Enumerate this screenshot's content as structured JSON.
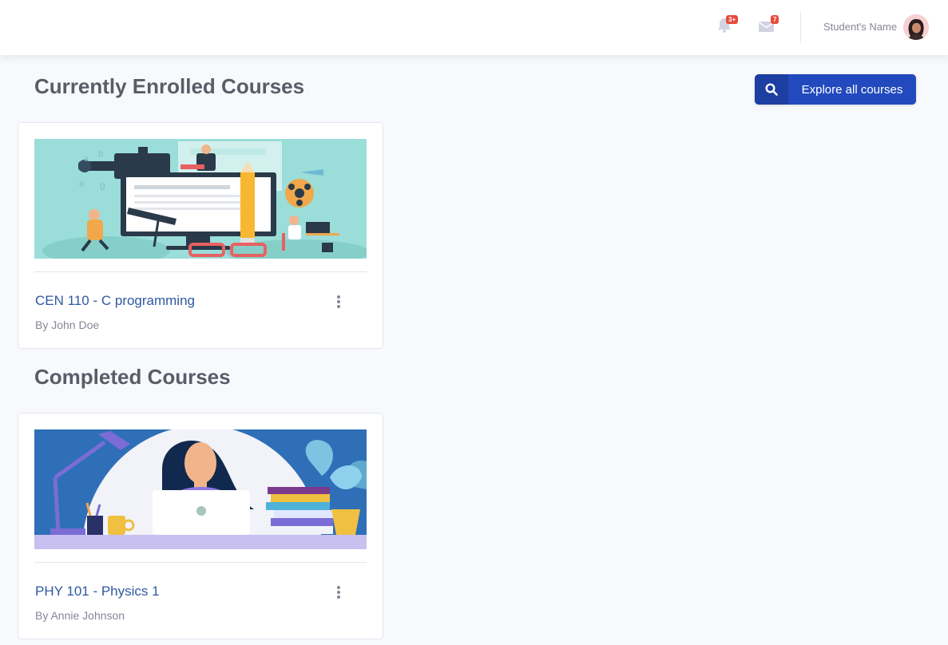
{
  "topbar": {
    "notifications": {
      "icon": "bell-icon",
      "badge": "3+"
    },
    "messages": {
      "icon": "envelope-icon",
      "badge": "7"
    },
    "user_name": "Student's Name"
  },
  "enrolled": {
    "title": "Currently Enrolled Courses",
    "explore_button": {
      "icon": "search-icon",
      "label": "Explore all courses"
    },
    "courses": [
      {
        "title": "CEN 110 - C programming",
        "author": "By John Doe"
      }
    ]
  },
  "completed": {
    "title": "Completed Courses",
    "courses": [
      {
        "title": "PHY 101 - Physics 1",
        "author": "By Annie Johnson"
      }
    ]
  },
  "colors": {
    "primary": "#224abe",
    "link": "#2e59a0",
    "badge": "#e74a3b",
    "heading": "#5a5c69",
    "muted": "#858796"
  }
}
